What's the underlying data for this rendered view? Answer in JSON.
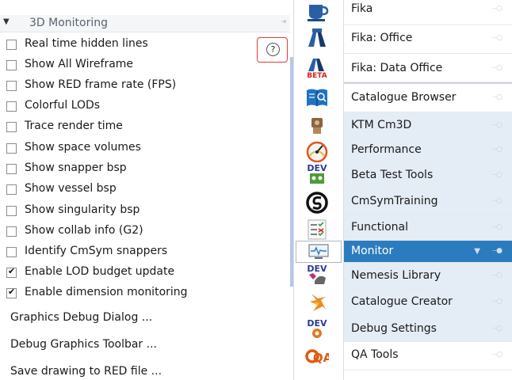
{
  "left_panel": {
    "section_title": "3D Monitoring",
    "checkboxes": [
      {
        "label": "Real time hidden lines",
        "checked": false
      },
      {
        "label": "Show All Wireframe",
        "checked": false
      },
      {
        "label": "Show RED frame rate (FPS)",
        "checked": false
      },
      {
        "label": "Colorful LODs",
        "checked": false
      },
      {
        "label": "Trace render time",
        "checked": false
      },
      {
        "label": "Show space volumes",
        "checked": false
      },
      {
        "label": "Show snapper bsp",
        "checked": false
      },
      {
        "label": "Show vessel bsp",
        "checked": false
      },
      {
        "label": "Show singularity bsp",
        "checked": false
      },
      {
        "label": "Show collab info (G2)",
        "checked": false
      },
      {
        "label": "Identify CmSym snappers",
        "checked": false
      },
      {
        "label": "Enable LOD budget update",
        "checked": true
      },
      {
        "label": "Enable dimension monitoring",
        "checked": true
      }
    ],
    "actions": [
      {
        "label": "Graphics Debug Dialog ..."
      },
      {
        "label": "Debug Graphics Toolbar ..."
      },
      {
        "label": "Save drawing to RED file ..."
      }
    ],
    "help_glyph": "?"
  },
  "icons": [
    {
      "name": "fika-cup-icon"
    },
    {
      "name": "fika-office-icon"
    },
    {
      "name": "fika-data-office-icon",
      "text": "BETA"
    },
    {
      "name": "catalogue-browser-icon"
    },
    {
      "name": "ktm-cm3d-icon"
    },
    {
      "name": "performance-gauge-icon"
    },
    {
      "name": "beta-test-tools-icon",
      "text": "DEV"
    },
    {
      "name": "cmsym-training-icon"
    },
    {
      "name": "functional-checklist-icon"
    },
    {
      "name": "monitor-icon"
    },
    {
      "name": "nemesis-library-icon",
      "text": "DEV"
    },
    {
      "name": "catalogue-creator-icon"
    },
    {
      "name": "debug-settings-icon",
      "text": "DEV"
    },
    {
      "name": "qa-tools-icon",
      "text": "QA"
    }
  ],
  "extensions": [
    {
      "label": "Fika"
    },
    {
      "label": "Fika: Office"
    },
    {
      "label": "Fika: Data Office"
    },
    {
      "label": "Catalogue Browser"
    },
    {
      "label": "KTM Cm3D"
    },
    {
      "label": "Performance"
    },
    {
      "label": "Beta Test Tools"
    },
    {
      "label": "CmSymTraining"
    },
    {
      "label": "Functional"
    },
    {
      "label": "Monitor"
    },
    {
      "label": "Nemesis Library"
    },
    {
      "label": "Catalogue Creator"
    },
    {
      "label": "Debug Settings"
    },
    {
      "label": "QA Tools"
    }
  ],
  "colors": {
    "active_item": "#2b7cbf",
    "item_highlight": "#e4ecf5",
    "help_border": "#e03a3a"
  }
}
